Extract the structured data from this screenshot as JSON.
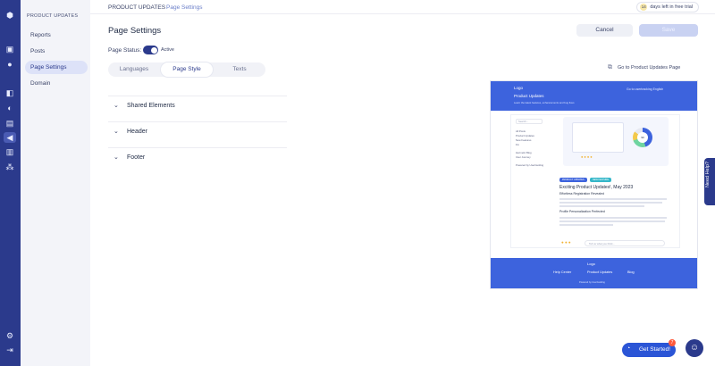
{
  "rail": {
    "icons": [
      "brand-logo-icon",
      "dashboard-icon",
      "users-icon",
      "guides-icon",
      "analytics-icon",
      "messages-icon",
      "product-updates-icon",
      "knowledge-base-icon",
      "integrations-icon",
      "settings-icon",
      "logout-icon"
    ]
  },
  "sidebar": {
    "header": "PRODUCT UPDATES",
    "items": [
      {
        "label": "Reports"
      },
      {
        "label": "Posts"
      },
      {
        "label": "Page Settings"
      },
      {
        "label": "Domain"
      }
    ],
    "active_item": "Page Settings"
  },
  "topbar": {
    "breadcrumb": [
      "PRODUCT UPDATES",
      "Page Settings"
    ],
    "separator": "›",
    "trial_days": "14",
    "trial_text": "days left in free trial"
  },
  "page": {
    "title": "Page Settings",
    "cancel_label": "Cancel",
    "save_label": "Save",
    "status_label": "Page Status:",
    "status_value": "Active",
    "status_on": true,
    "tabs": [
      {
        "label": "Languages"
      },
      {
        "label": "Page Style"
      },
      {
        "label": "Texts"
      }
    ],
    "active_tab": "Page Style",
    "goto_link": "Go to Product Updates Page",
    "sections": [
      {
        "label": "Shared Elements"
      },
      {
        "label": "Header"
      },
      {
        "label": "Footer"
      }
    ]
  },
  "preview": {
    "logo": "Logo",
    "nav": "Go to usertracking    English",
    "title": "Product Updates",
    "subtitle": "Learn the latest features, enhancements and bug fixes",
    "search_placeholder": "Search...",
    "filters": [
      "All Posts",
      "Product Updates",
      "New Features",
      "Fix",
      "Hermetic Blog",
      "User Journey",
      "Powered by UserGuiding"
    ],
    "donut_value": "90",
    "badge_1": "PRODUCT UPDATES",
    "badge_2": "NEW FEATURE",
    "post_title": "Exciting Product Updates!, May 2023",
    "heading_1": "Effortless Registration Revealed",
    "heading_2": "Profile Personalization Perfected",
    "reply_placeholder": "Tell us what you think...",
    "footer_logo": "Logo",
    "footer_links": [
      "Help Center",
      "Product Updates",
      "Blog"
    ],
    "powered": "Powered by UserGuiding"
  },
  "widgets": {
    "need_help": "Need Help?",
    "get_started": "Get Started!",
    "get_started_count": "7"
  },
  "colors": {
    "rail": "#2b3a8c",
    "accent": "#2b55d6",
    "preview_header": "#3d63dd"
  }
}
